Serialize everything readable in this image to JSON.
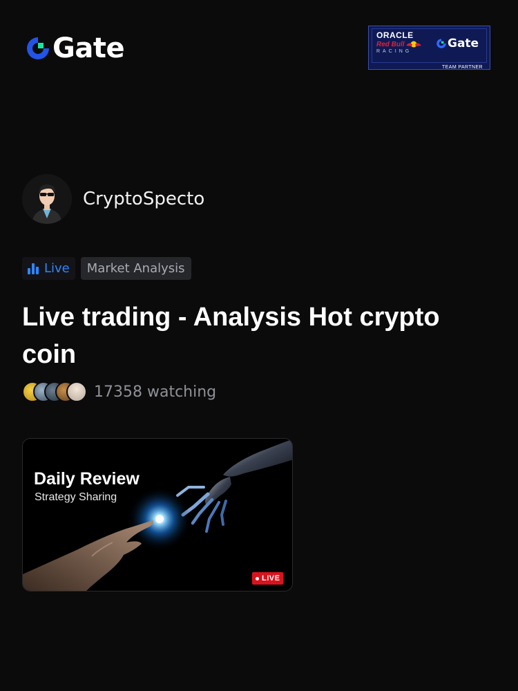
{
  "header": {
    "brand": "Gate",
    "partner": {
      "line1": "ORACLE",
      "line2": "Red Bull",
      "line3": "RACING",
      "brand": "Gate",
      "tagline": "TEAM PARTNER"
    }
  },
  "host": {
    "name": "CryptoSpecto",
    "avatar_icon": "avatar-icon"
  },
  "tags": {
    "live": "Live",
    "category": "Market Analysis"
  },
  "stream": {
    "title": "Live trading - Analysis Hot crypto coin",
    "watching": "17358 watching"
  },
  "thumbnail": {
    "title": "Daily Review",
    "subtitle": "Strategy Sharing",
    "badge": "LIVE"
  },
  "colors": {
    "background": "#0b0b0c",
    "accent_blue": "#2f86ff",
    "live_red": "#d9131d",
    "brand_green": "#17e6a1"
  }
}
